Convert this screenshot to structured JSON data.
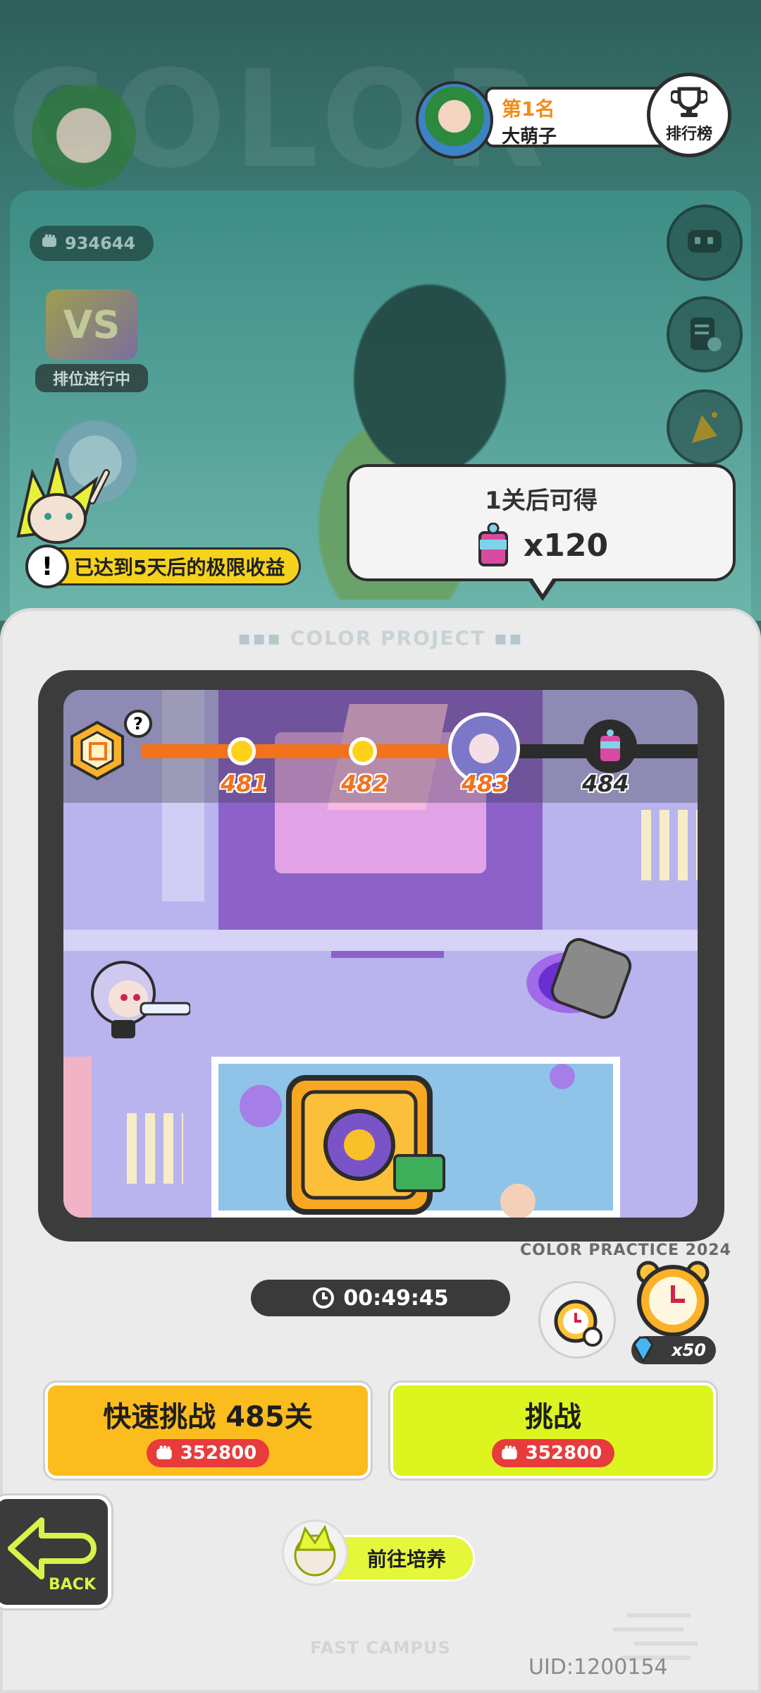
{
  "leaderboard": {
    "rank_label": "第1名",
    "player_name": "大萌子",
    "button_label": "排行榜"
  },
  "player": {
    "power_value": "934644",
    "ranked_status": "排位进行中"
  },
  "warning": {
    "text": "已达到5天后的极限收益"
  },
  "tooltip": {
    "title": "1关后可得",
    "quantity": "x120"
  },
  "panel": {
    "project_title": "COLOR PROJECT",
    "watermark": "COLOR PRACTICE 2024"
  },
  "progress": {
    "levels": [
      "481",
      "482",
      "483",
      "484"
    ],
    "current_level": "483"
  },
  "timer": {
    "value": "00:49:45"
  },
  "speedup": {
    "gem_cost": "x50"
  },
  "actions": {
    "quick_challenge_label": "快速挑战 485关",
    "quick_challenge_cost": "352800",
    "challenge_label": "挑战",
    "challenge_cost": "352800"
  },
  "navigation": {
    "back_label": "BACK",
    "train_label": "前往培养"
  },
  "footer": {
    "campus_label": "FAST CAMPUS",
    "uid": "UID:1200154"
  },
  "colors": {
    "accent_orange": "#f2731c",
    "quick_button": "#fbbc1e",
    "challenge_button": "#dcf51e",
    "cost_red": "#e83b3b",
    "warning_yellow": "#f5d31c"
  }
}
